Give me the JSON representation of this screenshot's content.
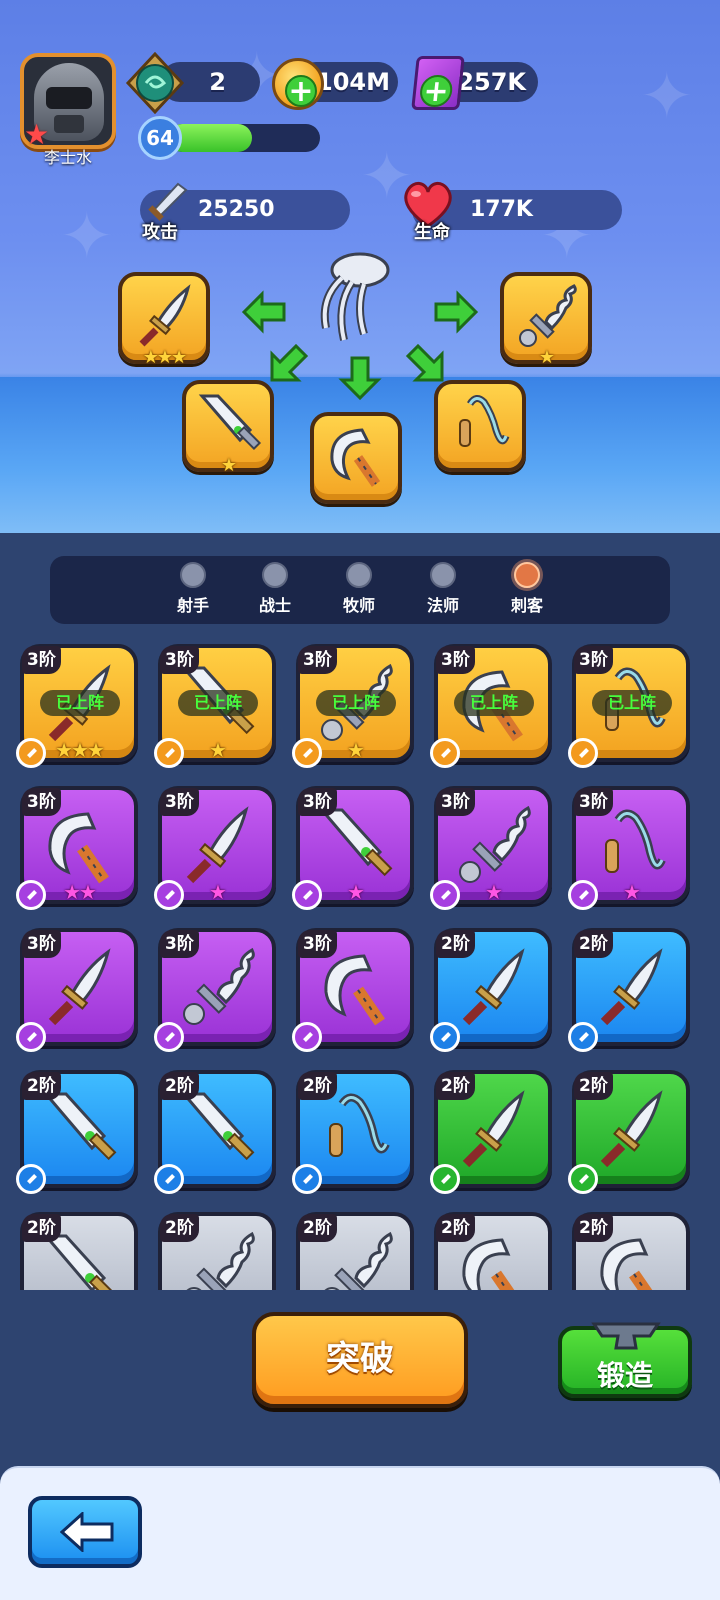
{
  "player": {
    "name": "李士水",
    "level": "64",
    "xp_fraction": 0.55
  },
  "currencies": {
    "gems": "2",
    "coins": "104M",
    "books": "257K"
  },
  "stats": {
    "attack_label": "攻击",
    "attack_value": "25250",
    "hp_label": "生命",
    "hp_value": "177K"
  },
  "loadout": {
    "center_icon": "claw-icon",
    "slots": [
      {
        "item": "dagger",
        "stars": "★★★"
      },
      {
        "item": "wavy-dagger",
        "stars": "★"
      },
      {
        "item": "broad-sword",
        "stars": "★"
      },
      {
        "item": "hook-blade",
        "stars": ""
      },
      {
        "item": "grappling-hook",
        "stars": ""
      }
    ]
  },
  "class_tabs": [
    {
      "label": "射手",
      "icon": "bow-icon",
      "active": false
    },
    {
      "label": "战士",
      "icon": "sword-icon",
      "active": false
    },
    {
      "label": "牧师",
      "icon": "cross-icon",
      "active": false
    },
    {
      "label": "法师",
      "icon": "wand-icon",
      "active": false
    },
    {
      "label": "刺客",
      "icon": "dagger-icon",
      "active": true
    }
  ],
  "inventory": [
    {
      "tier": "3阶",
      "rarity": "gold",
      "item": "dagger",
      "stars": "★★★",
      "star_color": "y",
      "equipped": "已上阵"
    },
    {
      "tier": "3阶",
      "rarity": "gold",
      "item": "broad-sword",
      "stars": "★",
      "star_color": "y",
      "equipped": "已上阵"
    },
    {
      "tier": "3阶",
      "rarity": "gold",
      "item": "wavy-dagger",
      "stars": "★",
      "star_color": "y",
      "equipped": "已上阵"
    },
    {
      "tier": "3阶",
      "rarity": "gold",
      "item": "hook-blade",
      "stars": "",
      "star_color": "y",
      "equipped": "已上阵"
    },
    {
      "tier": "3阶",
      "rarity": "gold",
      "item": "grappling-hook",
      "stars": "",
      "star_color": "y",
      "equipped": "已上阵"
    },
    {
      "tier": "3阶",
      "rarity": "purple",
      "item": "hook-blade",
      "stars": "★★",
      "star_color": "p",
      "equipped": ""
    },
    {
      "tier": "3阶",
      "rarity": "purple",
      "item": "dagger",
      "stars": "★",
      "star_color": "p",
      "equipped": ""
    },
    {
      "tier": "3阶",
      "rarity": "purple",
      "item": "broad-sword",
      "stars": "★",
      "star_color": "p",
      "equipped": ""
    },
    {
      "tier": "3阶",
      "rarity": "purple",
      "item": "wavy-dagger",
      "stars": "★",
      "star_color": "p",
      "equipped": ""
    },
    {
      "tier": "3阶",
      "rarity": "purple",
      "item": "grappling-hook",
      "stars": "★",
      "star_color": "p",
      "equipped": ""
    },
    {
      "tier": "3阶",
      "rarity": "purple",
      "item": "dagger",
      "stars": "",
      "star_color": "p",
      "equipped": ""
    },
    {
      "tier": "3阶",
      "rarity": "purple",
      "item": "wavy-dagger",
      "stars": "",
      "star_color": "p",
      "equipped": ""
    },
    {
      "tier": "3阶",
      "rarity": "purple",
      "item": "hook-blade",
      "stars": "",
      "star_color": "p",
      "equipped": ""
    },
    {
      "tier": "2阶",
      "rarity": "blue",
      "item": "dagger",
      "stars": "",
      "star_color": "y",
      "equipped": ""
    },
    {
      "tier": "2阶",
      "rarity": "blue",
      "item": "dagger",
      "stars": "",
      "star_color": "y",
      "equipped": ""
    },
    {
      "tier": "2阶",
      "rarity": "blue",
      "item": "broad-sword",
      "stars": "",
      "star_color": "y",
      "equipped": ""
    },
    {
      "tier": "2阶",
      "rarity": "blue",
      "item": "broad-sword",
      "stars": "",
      "star_color": "y",
      "equipped": ""
    },
    {
      "tier": "2阶",
      "rarity": "blue",
      "item": "grappling-hook",
      "stars": "",
      "star_color": "y",
      "equipped": ""
    },
    {
      "tier": "2阶",
      "rarity": "green",
      "item": "dagger",
      "stars": "",
      "star_color": "y",
      "equipped": ""
    },
    {
      "tier": "2阶",
      "rarity": "green",
      "item": "dagger",
      "stars": "",
      "star_color": "y",
      "equipped": ""
    },
    {
      "tier": "2阶",
      "rarity": "grey",
      "item": "broad-sword",
      "stars": "",
      "star_color": "y",
      "equipped": ""
    },
    {
      "tier": "2阶",
      "rarity": "grey",
      "item": "wavy-dagger",
      "stars": "",
      "star_color": "y",
      "equipped": ""
    },
    {
      "tier": "2阶",
      "rarity": "grey",
      "item": "wavy-dagger",
      "stars": "",
      "star_color": "y",
      "equipped": ""
    },
    {
      "tier": "2阶",
      "rarity": "grey",
      "item": "hook-blade",
      "stars": "",
      "star_color": "y",
      "equipped": ""
    },
    {
      "tier": "2阶",
      "rarity": "grey",
      "item": "hook-blade",
      "stars": "",
      "star_color": "y",
      "equipped": ""
    }
  ],
  "buttons": {
    "breakthrough": "突破",
    "forge": "锻造",
    "back_icon": "back-arrow-icon"
  }
}
